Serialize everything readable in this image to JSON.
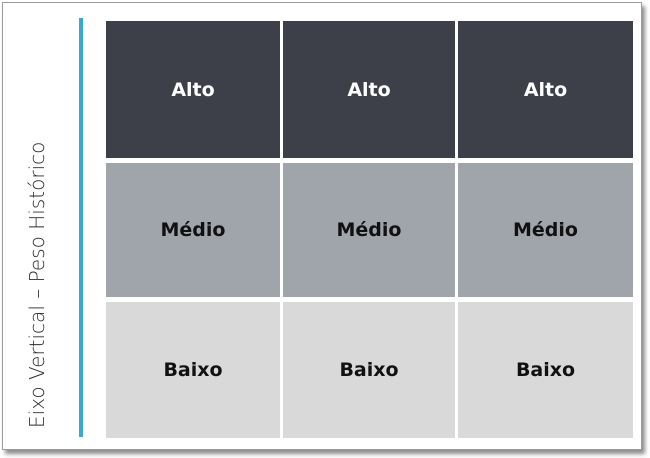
{
  "axis": {
    "label": "Eixo Vertical – Peso Histórico",
    "bar_color": "#3aa9d0"
  },
  "rows": [
    {
      "level": "alto",
      "color": "#3d4049",
      "cells": [
        "Alto",
        "Alto",
        "Alto"
      ]
    },
    {
      "level": "medio",
      "color": "#a0a4ab",
      "cells": [
        "Médio",
        "Médio",
        "Médio"
      ]
    },
    {
      "level": "baixo",
      "color": "#d9d9d9",
      "cells": [
        "Baixo",
        "Baixo",
        "Baixo"
      ]
    }
  ]
}
